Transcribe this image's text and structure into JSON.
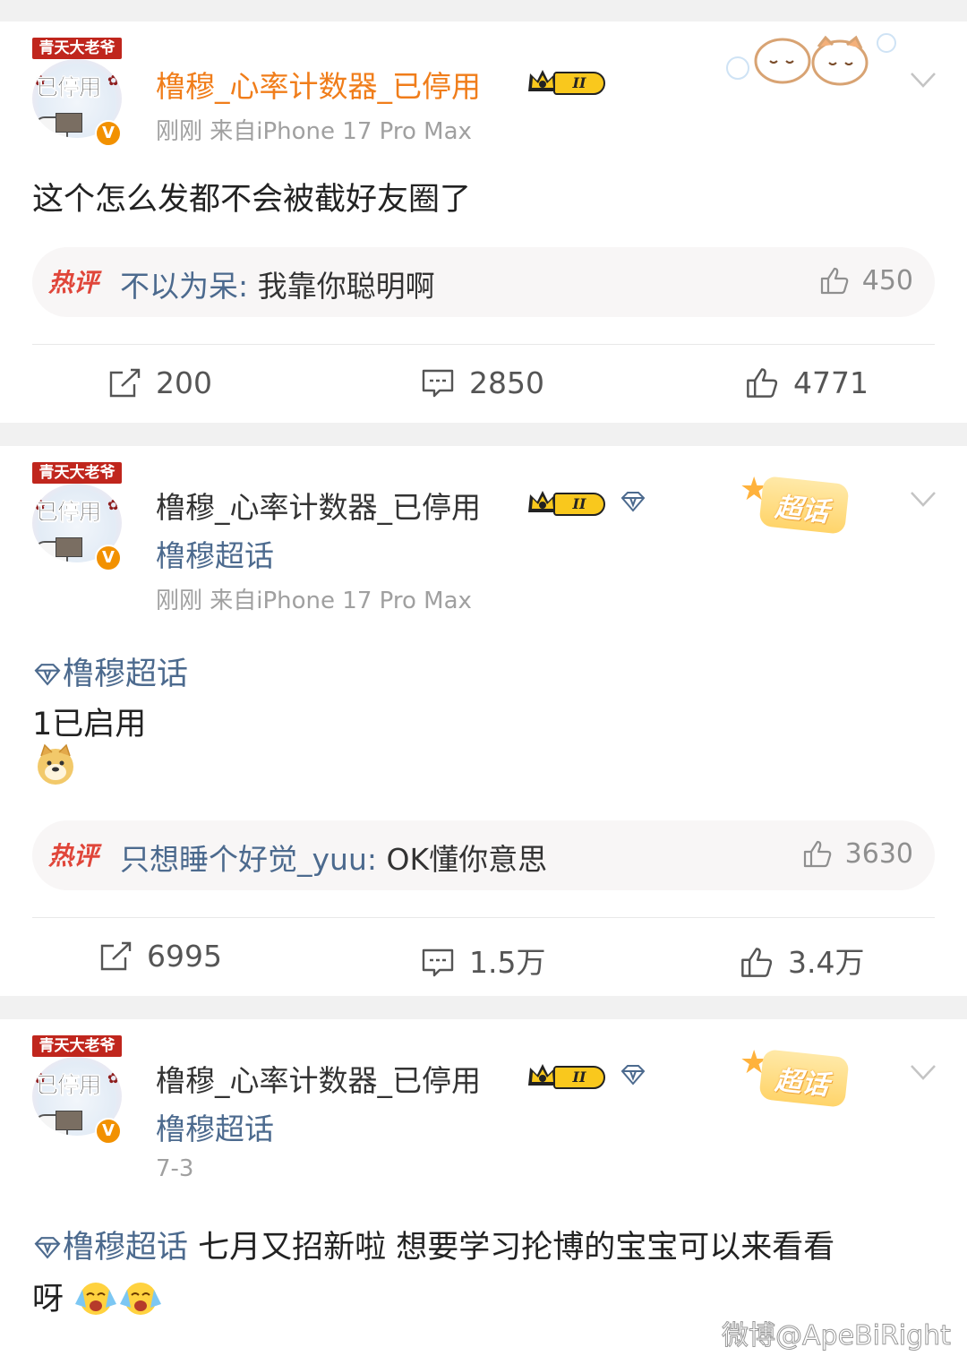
{
  "posts": [
    {
      "avatar": {
        "banner": "青天大老爷",
        "text": "已停用",
        "verified": "V"
      },
      "username": "橹穆_心率计数器_已停用",
      "rank_badge": "II",
      "meta": "刚刚  来自iPhone 17 Pro Max",
      "content": "这个怎么发都不会被截好友圈了",
      "hot_comment": {
        "label": "热评",
        "author": "不以为呆:",
        "text": " 我靠你聪明啊",
        "likes": "450"
      },
      "actions": {
        "reposts": "200",
        "comments": "2850",
        "likes": "4771"
      }
    },
    {
      "avatar": {
        "banner": "青天大老爷",
        "text": "已停用",
        "verified": "V"
      },
      "username": "橹穆_心率计数器_已停用",
      "rank_badge": "II",
      "supertopic": "橹穆超话",
      "super_badge": "超话",
      "meta": "刚刚  来自iPhone 17 Pro Max",
      "content_topic": "橹穆超话",
      "content_line": "1已启用",
      "hot_comment": {
        "label": "热评",
        "author": "只想睡个好觉_yuu:",
        "text": " OK懂你意思",
        "likes": "3630"
      },
      "actions": {
        "reposts": "6995",
        "comments": "1.5万",
        "likes": "3.4万"
      }
    },
    {
      "avatar": {
        "banner": "青天大老爷",
        "text": "已停用",
        "verified": "V"
      },
      "username": "橹穆_心率计数器_已停用",
      "rank_badge": "II",
      "supertopic": "橹穆超话",
      "super_badge": "超话",
      "meta": "7-3",
      "content_topic": "橹穆超话",
      "content_text": " 七月又招新啦  想要学习抡博的宝宝可以来看看",
      "content_line2": "呀"
    }
  ],
  "watermark": "微博@ApeBiRight",
  "colors": {
    "username_vip": "#f07d1a",
    "link": "#4c6a8e",
    "hot": "#e0463a",
    "verified": "#f29100"
  }
}
